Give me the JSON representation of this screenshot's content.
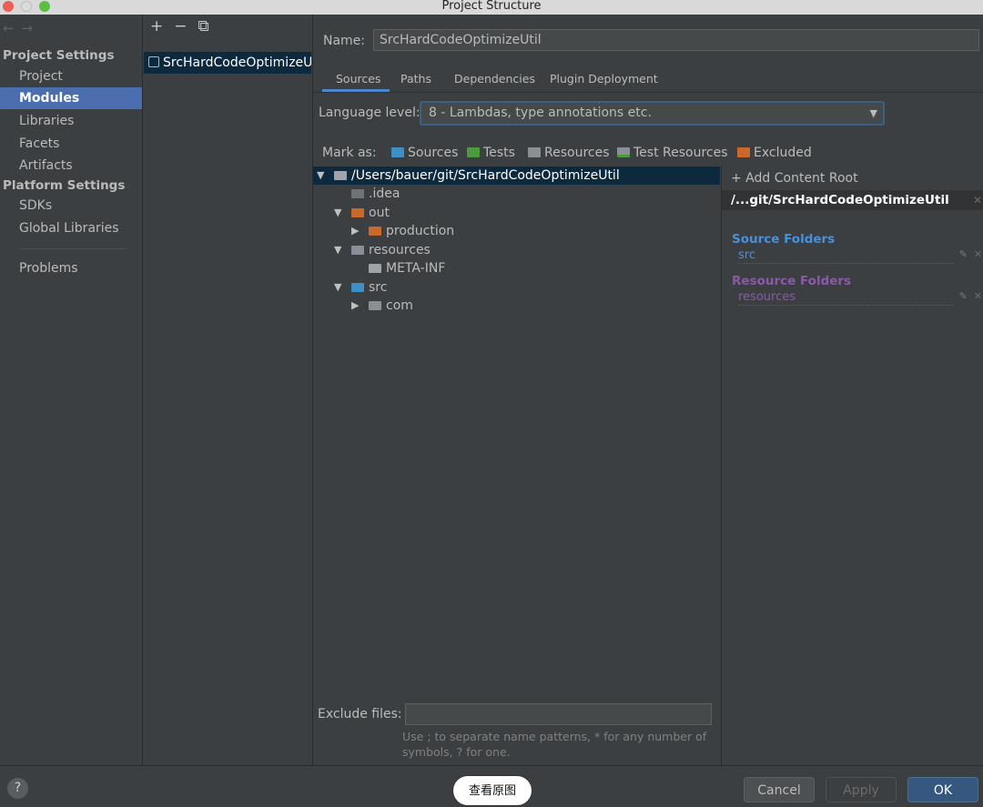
{
  "window": {
    "title": "Project Structure"
  },
  "sidebar": {
    "nav_back": "←",
    "nav_forward": "→",
    "project_settings_header": "Project Settings",
    "project_items": [
      "Project",
      "Modules",
      "Libraries",
      "Facets",
      "Artifacts"
    ],
    "platform_settings_header": "Platform Settings",
    "platform_items": [
      "SDKs",
      "Global Libraries"
    ],
    "problems": "Problems",
    "selected": "Modules"
  },
  "modules": {
    "add": "+",
    "remove": "−",
    "copy": "⧉",
    "items": [
      "SrcHardCodeOptimizeUtil"
    ]
  },
  "main": {
    "name_label": "Name:",
    "name_value": "SrcHardCodeOptimizeUtil",
    "tabs": [
      "Sources",
      "Paths",
      "Dependencies",
      "Plugin Deployment"
    ],
    "active_tab": "Sources",
    "language_label": "Language level:",
    "language_value": "8 - Lambdas, type annotations etc.",
    "mark_as_label": "Mark as:",
    "mark_as": [
      {
        "label": "Sources",
        "color": "#3d8fc6"
      },
      {
        "label": "Tests",
        "color": "#4c9a3e"
      },
      {
        "label": "Resources",
        "color": "#8a8f95"
      },
      {
        "label": "Test Resources",
        "color": "#8a8f95"
      },
      {
        "label": "Excluded",
        "color": "#c9682b"
      }
    ],
    "tree": {
      "root": "/Users/bauer/git/SrcHardCodeOptimizeUtil",
      "idea": ".idea",
      "out": "out",
      "production": "production",
      "resources": "resources",
      "meta_inf": "META-INF",
      "src": "src",
      "com": "com"
    },
    "exclude_label": "Exclude files:",
    "exclude_value": "",
    "exclude_hint": "Use ; to separate name patterns, * for any number of symbols, ? for one."
  },
  "content_root": {
    "add_label": "+ Add Content Root",
    "root_path": "/...git/SrcHardCodeOptimizeUtil",
    "source_folders_label": "Source Folders",
    "source_folders": [
      "src"
    ],
    "source_color": "#4a90d9",
    "resource_folders_label": "Resource Folders",
    "resource_folders": [
      "resources"
    ],
    "resource_color": "#8a5aa8"
  },
  "footer": {
    "help": "?",
    "cancel": "Cancel",
    "apply": "Apply",
    "ok": "OK",
    "overlay": "查看原图"
  }
}
